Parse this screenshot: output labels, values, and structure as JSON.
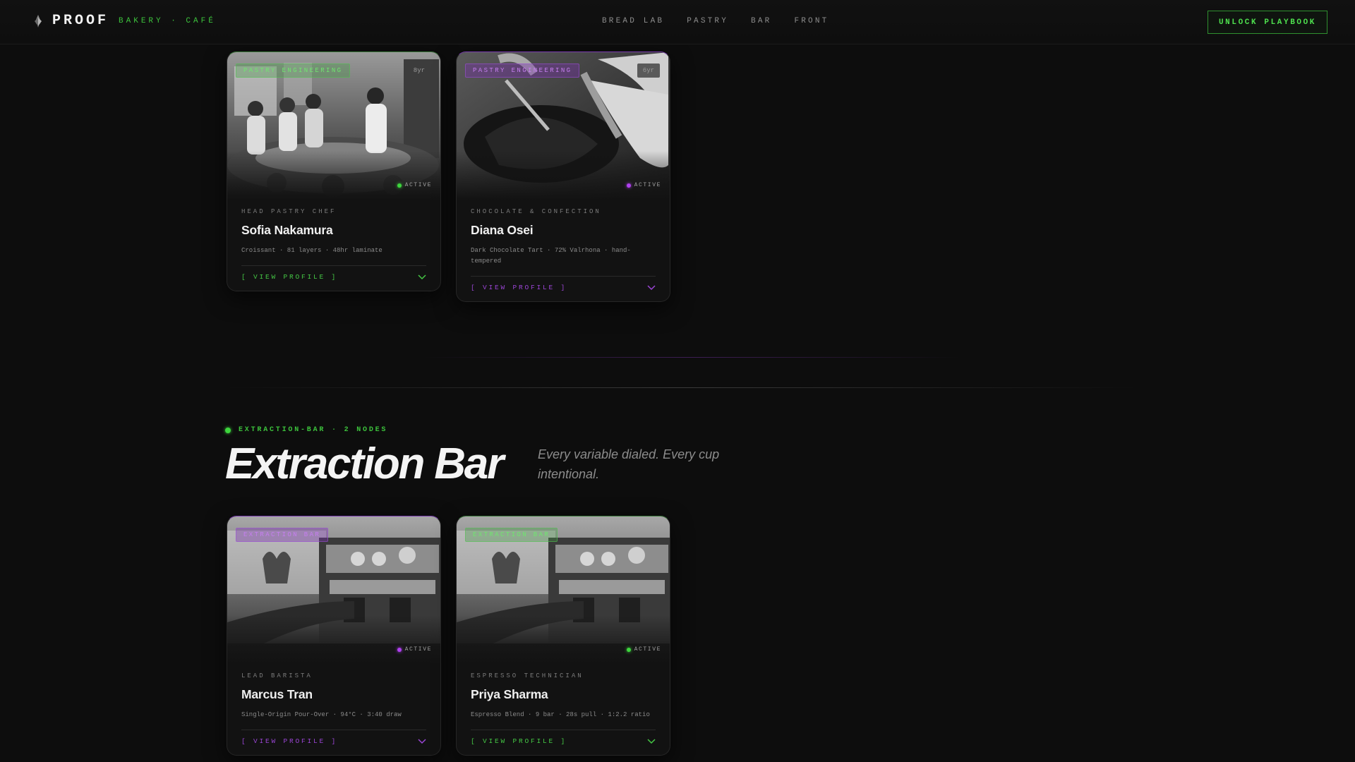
{
  "header": {
    "brand": "PROOF",
    "tagline": "BAKERY · CAFÉ",
    "nav": [
      "BREAD LAB",
      "PASTRY",
      "BAR",
      "FRONT"
    ],
    "cta": "UNLOCK PLAYBOOK"
  },
  "pastry_cards": [
    {
      "tag": "PASTRY ENGINEERING",
      "years": "8yr",
      "status": "ACTIVE",
      "role": "HEAD PASTRY CHEF",
      "name": "Sofia Nakamura",
      "spec": "Croissant · 81 layers · 48hr laminate",
      "view": "[ VIEW PROFILE ]"
    },
    {
      "tag": "PASTRY ENGINEERING",
      "years": "6yr",
      "status": "ACTIVE",
      "role": "CHOCOLATE & CONFECTION",
      "name": "Diana Osei",
      "spec": "Dark Chocolate Tart · 72% Valrhona · hand-tempered",
      "view": "[ VIEW PROFILE ]"
    }
  ],
  "section": {
    "label": "EXTRACTION-BAR · 2 NODES",
    "title": "Extraction Bar",
    "subtitle": "Every variable dialed. Every cup intentional."
  },
  "bar_cards": [
    {
      "tag": "EXTRACTION BAR",
      "status": "ACTIVE",
      "role": "LEAD BARISTA",
      "name": "Marcus Tran",
      "spec": "Single-Origin Pour-Over · 94°C · 3:40 draw",
      "view": "[ VIEW PROFILE ]"
    },
    {
      "tag": "EXTRACTION BAR",
      "status": "ACTIVE",
      "role": "ESPRESSO TECHNICIAN",
      "name": "Priya Sharma",
      "spec": "Espresso Blend · 9 bar · 28s pull · 1:2.2 ratio",
      "view": "[ VIEW PROFILE ]"
    }
  ],
  "colors": {
    "accent_green": "#3cc23c",
    "accent_purple": "#a040e0",
    "background": "#0d0d0d"
  }
}
